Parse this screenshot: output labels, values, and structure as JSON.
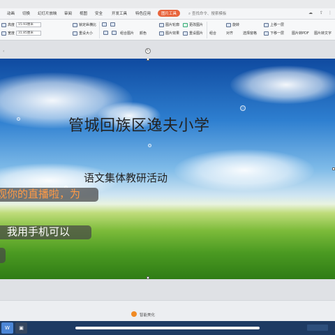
{
  "ribbon_tabs": [
    {
      "label": "动画"
    },
    {
      "label": "切换"
    },
    {
      "label": "幻灯片放映"
    },
    {
      "label": "审阅"
    },
    {
      "label": "视图"
    },
    {
      "label": "安全"
    },
    {
      "label": "开发工具"
    },
    {
      "label": "特色应用"
    },
    {
      "label": "图片工具"
    }
  ],
  "search_placeholder": "查找命令、搜索模板",
  "ribbon": {
    "height_label": "高度",
    "height_value": "15.93厘米",
    "width_label": "宽度",
    "width_value": "31.85厘米",
    "lock_ratio": "锁定纵横比",
    "reset_size": "重设大小",
    "combine": "组合图片",
    "color": "颜色",
    "picture_contour": "图片轮廓",
    "picture_effect": "图片效果",
    "change_picture": "更改图片",
    "reset_picture": "重设图片",
    "combine_objects": "组合",
    "align": "对齐",
    "rotate": "旋转",
    "selection_pane": "选择窗格",
    "bring_forward": "上移一层",
    "send_backward": "下移一层",
    "to_pdf": "图片转PDF",
    "to_text": "图片转文字"
  },
  "slide": {
    "title": "管城回族区逸夫小学",
    "subtitle": "语文集体教研活动"
  },
  "live_comments": [
    {
      "text": "观你的直播啦，为"
    },
    {
      "text": "，我用手机可以"
    },
    {
      "text": ""
    }
  ],
  "status": {
    "text": "智能美化"
  },
  "taskbar": {
    "start_label": "W"
  },
  "colors": {
    "accent_tab": "#e8643c",
    "comment_orange": "#ff9a45",
    "taskbar": "#1e3b63"
  }
}
